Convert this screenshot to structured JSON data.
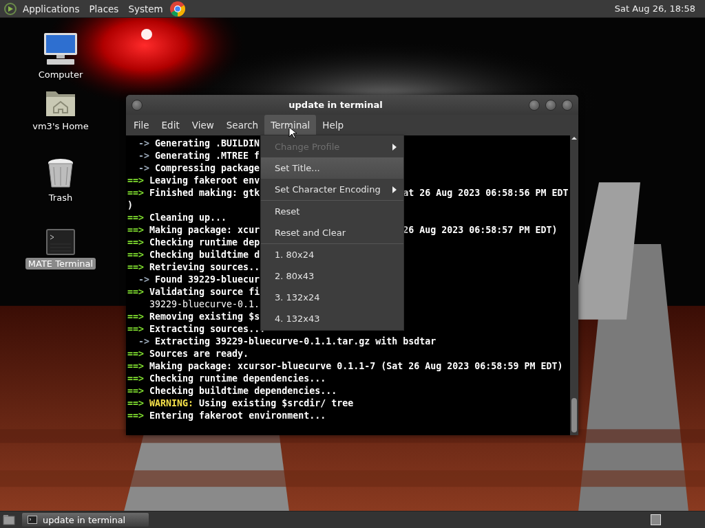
{
  "top_panel": {
    "menus": [
      {
        "label": "Applications"
      },
      {
        "label": "Places"
      },
      {
        "label": "System"
      }
    ],
    "clock": "Sat Aug 26, 18:58"
  },
  "desktop_icons": [
    {
      "label": "Computer",
      "kind": "computer",
      "selected": false
    },
    {
      "label": "vm3's Home",
      "kind": "home",
      "selected": false
    },
    {
      "label": "Trash",
      "kind": "trash",
      "selected": false
    },
    {
      "label": "MATE Terminal",
      "kind": "terminal",
      "selected": true
    }
  ],
  "window": {
    "title": "update in terminal",
    "menu_bar": [
      {
        "label": "File",
        "selected": false
      },
      {
        "label": "Edit",
        "selected": false
      },
      {
        "label": "View",
        "selected": false
      },
      {
        "label": "Search",
        "selected": false
      },
      {
        "label": "Terminal",
        "selected": true
      },
      {
        "label": "Help",
        "selected": false
      }
    ],
    "terminal_lines": [
      {
        "kind": "sub",
        "prefix": "->",
        "text": "Generating .BUILDIN"
      },
      {
        "kind": "sub",
        "prefix": "->",
        "text": "Generating .MTREE f"
      },
      {
        "kind": "sub",
        "prefix": "->",
        "text": "Compressing package"
      },
      {
        "kind": "step",
        "prefix": "==>",
        "text": "Leaving fakeroot env"
      },
      {
        "kind": "step",
        "prefix": "==>",
        "text": "Finished making: gtk",
        "right": "at 26 Aug 2023 06:58:56 PM EDT"
      },
      {
        "kind": "plain",
        "text": ")"
      },
      {
        "kind": "step",
        "prefix": "==>",
        "text": "Cleaning up..."
      },
      {
        "kind": "step",
        "prefix": "==>",
        "text": "Making package: xcur",
        "right": "26 Aug 2023 06:58:57 PM EDT)"
      },
      {
        "kind": "step",
        "prefix": "==>",
        "text": "Checking runtime dep"
      },
      {
        "kind": "step",
        "prefix": "==>",
        "text": "Checking buildtime d"
      },
      {
        "kind": "step",
        "prefix": "==>",
        "text": "Retrieving sources.."
      },
      {
        "kind": "sub",
        "prefix": "->",
        "text": "Found 39229-bluecur"
      },
      {
        "kind": "step",
        "prefix": "==>",
        "text": "Validating source fi"
      },
      {
        "kind": "cont",
        "text": "39229-bluecurve-0.1."
      },
      {
        "kind": "step",
        "prefix": "==>",
        "text": "Removing existing $s"
      },
      {
        "kind": "step",
        "prefix": "==>",
        "text": "Extracting sources..."
      },
      {
        "kind": "sub",
        "prefix": "->",
        "text": "Extracting 39229-bluecurve-0.1.1.tar.gz with bsdtar"
      },
      {
        "kind": "step",
        "prefix": "==>",
        "text": "Sources are ready."
      },
      {
        "kind": "step",
        "prefix": "==>",
        "text": "Making package: xcursor-bluecurve 0.1.1-7 (Sat 26 Aug 2023 06:58:59 PM EDT)"
      },
      {
        "kind": "step",
        "prefix": "==>",
        "text": "Checking runtime dependencies..."
      },
      {
        "kind": "step",
        "prefix": "==>",
        "text": "Checking buildtime dependencies..."
      },
      {
        "kind": "warning",
        "prefix": "==>",
        "label": "WARNING:",
        "text": "Using existing $srcdir/ tree"
      },
      {
        "kind": "step",
        "prefix": "==>",
        "text": "Entering fakeroot environment..."
      }
    ]
  },
  "dropdown_menu": {
    "items": [
      {
        "kind": "item",
        "label": "Change Profile",
        "disabled": true,
        "submenu": true,
        "selected": false
      },
      {
        "kind": "item",
        "label": "Set Title...",
        "disabled": false,
        "submenu": false,
        "selected": true
      },
      {
        "kind": "item",
        "label": "Set Character Encoding",
        "disabled": false,
        "submenu": true,
        "selected": false
      },
      {
        "kind": "separator"
      },
      {
        "kind": "item",
        "label": "Reset",
        "disabled": false,
        "submenu": false,
        "selected": false
      },
      {
        "kind": "item",
        "label": "Reset and Clear",
        "disabled": false,
        "submenu": false,
        "selected": false
      },
      {
        "kind": "separator"
      },
      {
        "kind": "item",
        "label": "1. 80x24",
        "disabled": false,
        "submenu": false,
        "selected": false
      },
      {
        "kind": "item",
        "label": "2. 80x43",
        "disabled": false,
        "submenu": false,
        "selected": false
      },
      {
        "kind": "item",
        "label": "3. 132x24",
        "disabled": false,
        "submenu": false,
        "selected": false
      },
      {
        "kind": "item",
        "label": "4. 132x43",
        "disabled": false,
        "submenu": false,
        "selected": false
      }
    ]
  },
  "taskbar": {
    "tasks": [
      {
        "label": "update in terminal",
        "selected": true
      }
    ]
  }
}
